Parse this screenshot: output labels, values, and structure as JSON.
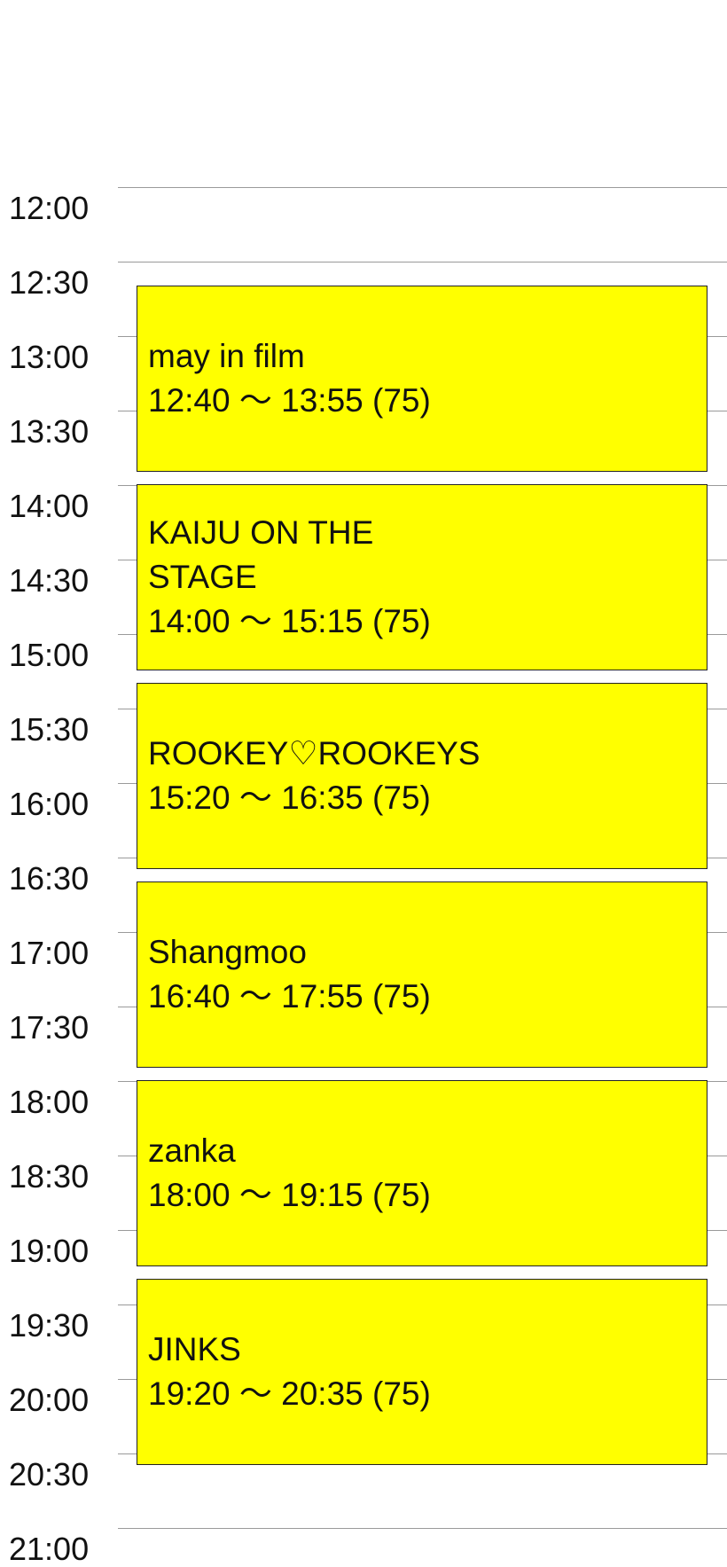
{
  "timeline": {
    "slots": [
      "12:00",
      "12:30",
      "13:00",
      "13:30",
      "14:00",
      "14:30",
      "15:00",
      "15:30",
      "16:00",
      "16:30",
      "17:00",
      "17:30",
      "18:00",
      "18:30",
      "19:00",
      "19:30",
      "20:00",
      "20:30",
      "21:00"
    ]
  },
  "events": [
    {
      "name": "may in film",
      "time": "12:40 〜 13:55 (75)"
    },
    {
      "name": "KAIJU ON THE STAGE",
      "time": "14:00 〜 15:15 (75)"
    },
    {
      "name": "ROOKEY♡ROOKEYS",
      "time": "15:20 〜 16:35 (75)"
    },
    {
      "name": "Shangmoo",
      "time": "16:40 〜 17:55 (75)"
    },
    {
      "name": "zanka",
      "time": "18:00 〜 19:15 (75)"
    },
    {
      "name": "JINKS",
      "time": "19:20 〜 20:35 (75)"
    }
  ],
  "colors": {
    "event_background": "#ffff00",
    "grid_line": "#9a9a9a"
  }
}
